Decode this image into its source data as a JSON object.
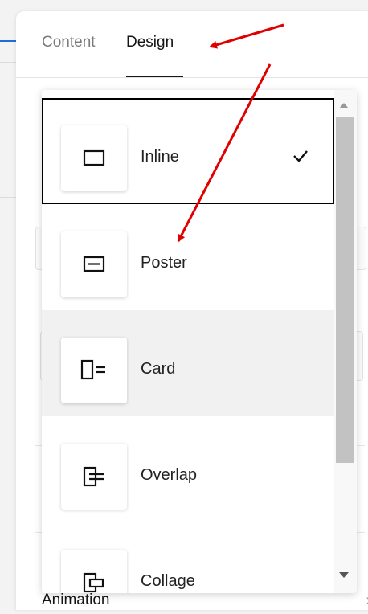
{
  "tabs": {
    "content_label": "Content",
    "design_label": "Design",
    "active": "Design"
  },
  "dropdown": {
    "options": [
      {
        "label": "Inline",
        "icon": "layout-inline-icon",
        "selected": true
      },
      {
        "label": "Poster",
        "icon": "layout-poster-icon",
        "selected": false
      },
      {
        "label": "Card",
        "icon": "layout-card-icon",
        "selected": false,
        "hovered": true
      },
      {
        "label": "Overlap",
        "icon": "layout-overlap-icon",
        "selected": false
      },
      {
        "label": "Collage",
        "icon": "layout-collage-icon",
        "selected": false
      }
    ],
    "selected_marker": "checkmark-icon"
  },
  "animation": {
    "label": "Animation"
  },
  "colors": {
    "accent_blue": "#1a6fd6",
    "annotation_arrow": "#e00000",
    "selected_border": "#000000",
    "hover_bg": "#f1f1f1"
  }
}
